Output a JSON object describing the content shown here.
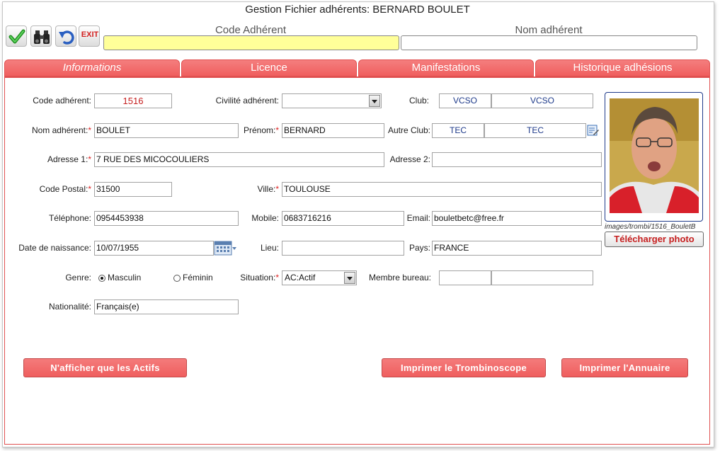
{
  "window": {
    "title": "Gestion Fichier adhérents: BERNARD BOULET"
  },
  "toolbar": {
    "validate_icon": "checkmark-icon",
    "search_icon": "binoculars-icon",
    "undo_icon": "undo-icon",
    "exit_label": "EXIT"
  },
  "header": {
    "code_label": "Code Adhérent",
    "code_value": "",
    "name_label": "Nom adhérent",
    "name_value": ""
  },
  "tabs": [
    {
      "label": "Informations",
      "active": true
    },
    {
      "label": "Licence",
      "active": false
    },
    {
      "label": "Manifestations",
      "active": false
    },
    {
      "label": "Historique adhésions",
      "active": false
    }
  ],
  "form": {
    "code_adherent": {
      "label": "Code adhérent:",
      "value": "1516"
    },
    "civilite": {
      "label": "Civilité adhérent:",
      "value": ""
    },
    "club": {
      "label": "Club:",
      "value1": "VCSO",
      "value2": "VCSO"
    },
    "nom": {
      "label": "Nom adhérent:",
      "required": "*",
      "value": "BOULET"
    },
    "prenom": {
      "label": "Prénom:",
      "required": "*",
      "value": "BERNARD"
    },
    "autre_club": {
      "label": "Autre Club:",
      "value1": "TEC",
      "value2": "TEC"
    },
    "adresse1": {
      "label": "Adresse 1:",
      "required": "*",
      "value": "7 RUE DES MICOCOULIERS"
    },
    "adresse2": {
      "label": "Adresse 2:",
      "value": ""
    },
    "code_postal": {
      "label": "Code Postal:",
      "required": "*",
      "value": "31500"
    },
    "ville": {
      "label": "Ville:",
      "required": "*",
      "value": "TOULOUSE"
    },
    "telephone": {
      "label": "Téléphone:",
      "value": "0954453938"
    },
    "mobile": {
      "label": "Mobile:",
      "value": "0683716216"
    },
    "email": {
      "label": "Email:",
      "value": "bouletbetc@free.fr"
    },
    "date_naissance": {
      "label": "Date de naissance:",
      "value": "10/07/1955"
    },
    "lieu": {
      "label": "Lieu:",
      "value": ""
    },
    "pays": {
      "label": "Pays:",
      "value": "FRANCE"
    },
    "genre": {
      "label": "Genre:",
      "option1": "Masculin",
      "option2": "Féminin",
      "selected": "Masculin"
    },
    "situation": {
      "label": "Situation:",
      "required": "*",
      "value": "AC:Actif"
    },
    "membre_bureau": {
      "label": "Membre bureau:",
      "value1": "",
      "value2": ""
    },
    "nationalite": {
      "label": "Nationalité:",
      "value": "Français(e)"
    }
  },
  "photo": {
    "path": "images/trombi/1516_BouletB",
    "upload_label": "Télécharger photo"
  },
  "buttons": {
    "only_active": "N'afficher que les Actifs",
    "print_trombi": "Imprimer le Trombinoscope",
    "print_annuaire": "Imprimer l'Annuaire"
  },
  "colors": {
    "accent": "#f06262",
    "header_input": "#ffff99",
    "required": "#d22222"
  }
}
